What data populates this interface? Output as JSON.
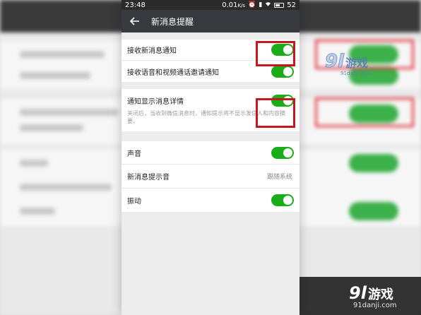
{
  "status_bar": {
    "time": "23:48",
    "speed": "0.01",
    "speed_unit": "K/s",
    "battery": "52"
  },
  "header": {
    "title": "新消息提醒"
  },
  "settings": {
    "receive_new_message": {
      "label": "接收新消息通知",
      "enabled": true
    },
    "receive_call_invites": {
      "label": "接收语音和视频通话邀请通知",
      "enabled": true
    },
    "show_message_details": {
      "label": "通知显示消息详情",
      "enabled": true,
      "description": "关闭后，当收到微信消息时，通知提示将不显示发信人和内容摘要。"
    },
    "sound": {
      "label": "声音",
      "enabled": true
    },
    "ringtone": {
      "label": "新消息提示音",
      "value": "跟随系统"
    },
    "vibrate": {
      "label": "振动",
      "enabled": true
    }
  },
  "watermark": {
    "number": "9l",
    "name": "游戏",
    "url_small": "91danji.com",
    "url": "91danji.com"
  },
  "colors": {
    "toggle_on": "#1aad19",
    "highlight": "#c8161d",
    "titlebar": "#393a3f"
  }
}
